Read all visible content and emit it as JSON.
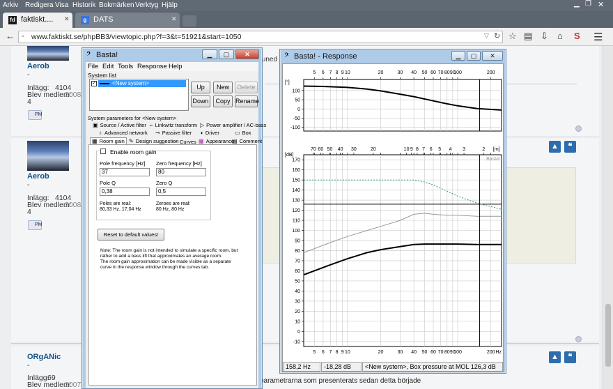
{
  "browser": {
    "menu": [
      "Arkiv",
      "Redigera",
      "Visa",
      "Historik",
      "Bokmärken",
      "Verktyg",
      "Hjälp"
    ],
    "tabs": [
      {
        "label": "faktiskt....",
        "icon": "fk-icon"
      },
      {
        "label": "DATS",
        "icon": "google-icon"
      }
    ],
    "url": "www.faktiskt.se/phpBB3/viewtopic.php?f=3&t=51921&start=1050"
  },
  "forum": {
    "posts": [
      {
        "user": "Aerob",
        "dash": "-",
        "posts_label": "Inlägg:",
        "posts": "4104",
        "member_label": "Blev medlem:",
        "member": "2008-0",
        "extra": "4",
        "pm": "PM"
      },
      {
        "user": "Aerob",
        "dash": "-",
        "posts_label": "Inlägg:",
        "posts": "4104",
        "member_label": "Blev medlem:",
        "member": "2008-0",
        "extra": "4",
        "pm": "PM"
      },
      {
        "user": "ORgANic",
        "dash": "-",
        "posts_label": "Inlägg:",
        "posts": "69",
        "member_label": "Blev medlem:",
        "member": "2007"
      }
    ],
    "snippet_top": "tuned",
    "snippet_bottom": "parametrarna som presenterats sedan detta började"
  },
  "basta": {
    "title": "Basta!",
    "menu": [
      "File",
      "Edit",
      "Tools",
      "Response",
      "Help"
    ],
    "system_list_label": "System list",
    "system_item": "<New system>",
    "buttons": {
      "up": "Up",
      "new": "New",
      "delete": "Delete",
      "down": "Down",
      "copy": "Copy",
      "rename": "Rename"
    },
    "params_label": "System parameters for <New system>",
    "tabs_row1": [
      {
        "icon": "source-icon",
        "label": "Source / Active filter"
      },
      {
        "icon": "linkwitz-icon",
        "label": "Linkwitz transform"
      },
      {
        "icon": "amp-icon",
        "label": "Power amplifier / AC-bass"
      }
    ],
    "tabs_row2": [
      {
        "icon": "network-icon",
        "label": "Advanced network"
      },
      {
        "icon": "passive-icon",
        "label": "Passive filter"
      },
      {
        "icon": "driver-icon",
        "label": "Driver"
      },
      {
        "icon": "box-icon",
        "label": "Box"
      }
    ],
    "tabs_row3": [
      {
        "icon": "room-icon",
        "label": "Room gain"
      },
      {
        "icon": "design-icon",
        "label": "Design suggestion"
      },
      {
        "icon": "curves-icon",
        "label": "Curves"
      },
      {
        "icon": "appearance-icon",
        "label": "Appearance"
      },
      {
        "icon": "comment-icon",
        "label": "Comment"
      }
    ],
    "room_gain": {
      "enable_label": "Enable room gain",
      "pole_freq_label": "Pole frequency [Hz]",
      "pole_freq": "37",
      "zero_freq_label": "Zero frequency [Hz]",
      "zero_freq": "80",
      "pole_q_label": "Pole Q",
      "pole_q": "0,38",
      "zero_q_label": "Zero Q",
      "zero_q": "0,5",
      "poles_real": "Poles are real:",
      "poles_values": "80,33 Hz, 17,04 Hz",
      "zeroes_real": "Zeroes are real:",
      "zeroes_values": "80 Hz, 80 Hz",
      "reset_label": "Reset to default values!",
      "note_lines": [
        "Note: The room gain is not intended to simulate a specific room, but",
        "rather to add a bass lift that approximates an average room.",
        "The room gain approximation can be made visible as a separate",
        "curve in the response window through the curves tab."
      ]
    }
  },
  "response": {
    "title": "Basta! - Response",
    "status": [
      "158,2 Hz",
      "-18,28 dB",
      "<New system>, Box pressure at MOL 126,3 dB"
    ],
    "watermark": "Basta!",
    "units": {
      "phase": "[°]",
      "db": "[dB]",
      "m": "[m]",
      "hz": "Hz"
    }
  },
  "chart_data": [
    {
      "type": "line",
      "title": "Phase",
      "ylabel": "[°]",
      "xscale": "log",
      "xlim": [
        4,
        250
      ],
      "ylim": [
        -120,
        160
      ],
      "x_ticks": [
        5,
        6,
        7,
        8,
        9,
        10,
        20,
        30,
        40,
        50,
        60,
        70,
        80,
        90,
        100,
        200
      ],
      "y_ticks": [
        100,
        50,
        0,
        -50,
        -100
      ],
      "grid": true,
      "series": [
        {
          "color": "#000000",
          "x": [
            4,
            6,
            10,
            15,
            20,
            30,
            40,
            60,
            80,
            100,
            150,
            250
          ],
          "y": [
            124,
            122,
            117,
            108,
            98,
            80,
            67,
            44,
            28,
            17,
            2,
            -6
          ]
        }
      ]
    },
    {
      "type": "line",
      "title": "SPL",
      "ylabel": "[dB]",
      "xscale": "log",
      "xlim": [
        4,
        250
      ],
      "ylim": [
        -15,
        175
      ],
      "x_ticks": [
        5,
        6,
        7,
        8,
        9,
        10,
        20,
        30,
        40,
        50,
        60,
        70,
        80,
        90,
        100,
        200
      ],
      "y_ticks": [
        170,
        160,
        150,
        140,
        130,
        120,
        110,
        100,
        90,
        80,
        70,
        60,
        50,
        40,
        30,
        20,
        10,
        0,
        -10
      ],
      "top_axis_label": "[m]",
      "top_axis_ticks": [
        "70",
        "60",
        "50",
        "40",
        "30",
        "20",
        "10",
        "9",
        "8",
        "7",
        "6",
        "5",
        "4",
        "3",
        "2"
      ],
      "grid": true,
      "hline": 126,
      "series": [
        {
          "name": "",
          "color": "#000000",
          "x": [
            4,
            5,
            7,
            10,
            15,
            20,
            30,
            40,
            50,
            60,
            80,
            100,
            150,
            250
          ],
          "y": [
            56,
            60,
            66,
            72,
            78,
            81,
            84,
            86,
            86.5,
            86.5,
            86.5,
            86.5,
            86,
            86
          ]
        },
        {
          "name": "",
          "color": "#9a9a9a",
          "x": [
            4,
            5,
            7,
            10,
            15,
            20,
            30,
            40,
            50,
            60,
            80,
            100,
            150,
            250
          ],
          "y": [
            78,
            82,
            88,
            94,
            100,
            104,
            110,
            116,
            117,
            116,
            115,
            115,
            114,
            114
          ]
        },
        {
          "name": "",
          "color": "#2b9a7a",
          "dashed": true,
          "x": [
            4,
            10,
            20,
            40,
            50,
            60,
            80,
            100,
            150,
            250
          ],
          "y": [
            150,
            150,
            150,
            150,
            148,
            145,
            139,
            134,
            127,
            121
          ]
        }
      ]
    }
  ]
}
